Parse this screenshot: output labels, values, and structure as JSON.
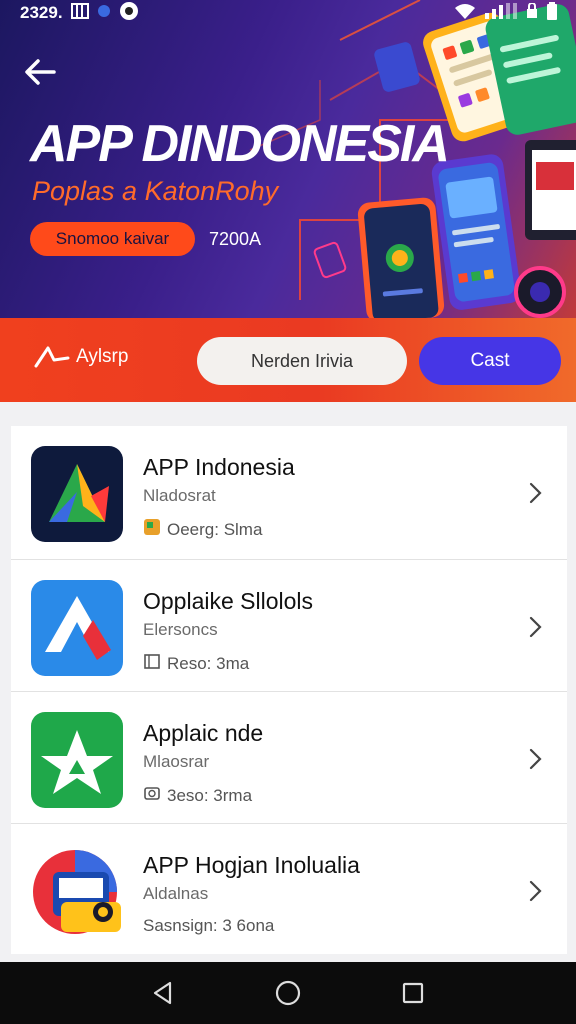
{
  "status_bar": {
    "time": "2329.",
    "icons": [
      "gallery-icon",
      "chat-icon",
      "sync-icon",
      "wifi-icon",
      "signal-icon",
      "lock-icon",
      "battery-icon"
    ]
  },
  "hero": {
    "title": "APP DINDONESIA",
    "subtitle": "Poplas a KatonRohy",
    "pill_label": "Snomoo kaivar",
    "count": "7200A"
  },
  "action_bar": {
    "brand_label": "Aylsrp",
    "secondary_button": "Nerden Irivia",
    "primary_button": "Cast"
  },
  "apps": [
    {
      "title": "APP Indonesia",
      "subtitle": "Nladosrat",
      "meta": "Oeerg: Slma",
      "icon": "triangle-logo-icon"
    },
    {
      "title": "Opplaike Sllolols",
      "subtitle": "Elersoncs",
      "meta": "Reso: 3ma",
      "icon": "arrow-logo-icon"
    },
    {
      "title": "Applaic nde",
      "subtitle": "Mlaosrar",
      "meta": "3eso: 3rma",
      "icon": "star-logo-icon"
    },
    {
      "title": "APP Hogjan Inolualia",
      "subtitle": "Aldalnas",
      "meta": "Sasnsign: 3 6ona",
      "icon": "bus-logo-icon"
    }
  ],
  "colors": {
    "hero_bg": "#2a1b78",
    "accent_orange": "#f0401e",
    "primary_blue": "#4636e6",
    "nav_bg": "#0c0c0c"
  },
  "nav": [
    "back-icon",
    "home-icon",
    "recents-icon"
  ]
}
